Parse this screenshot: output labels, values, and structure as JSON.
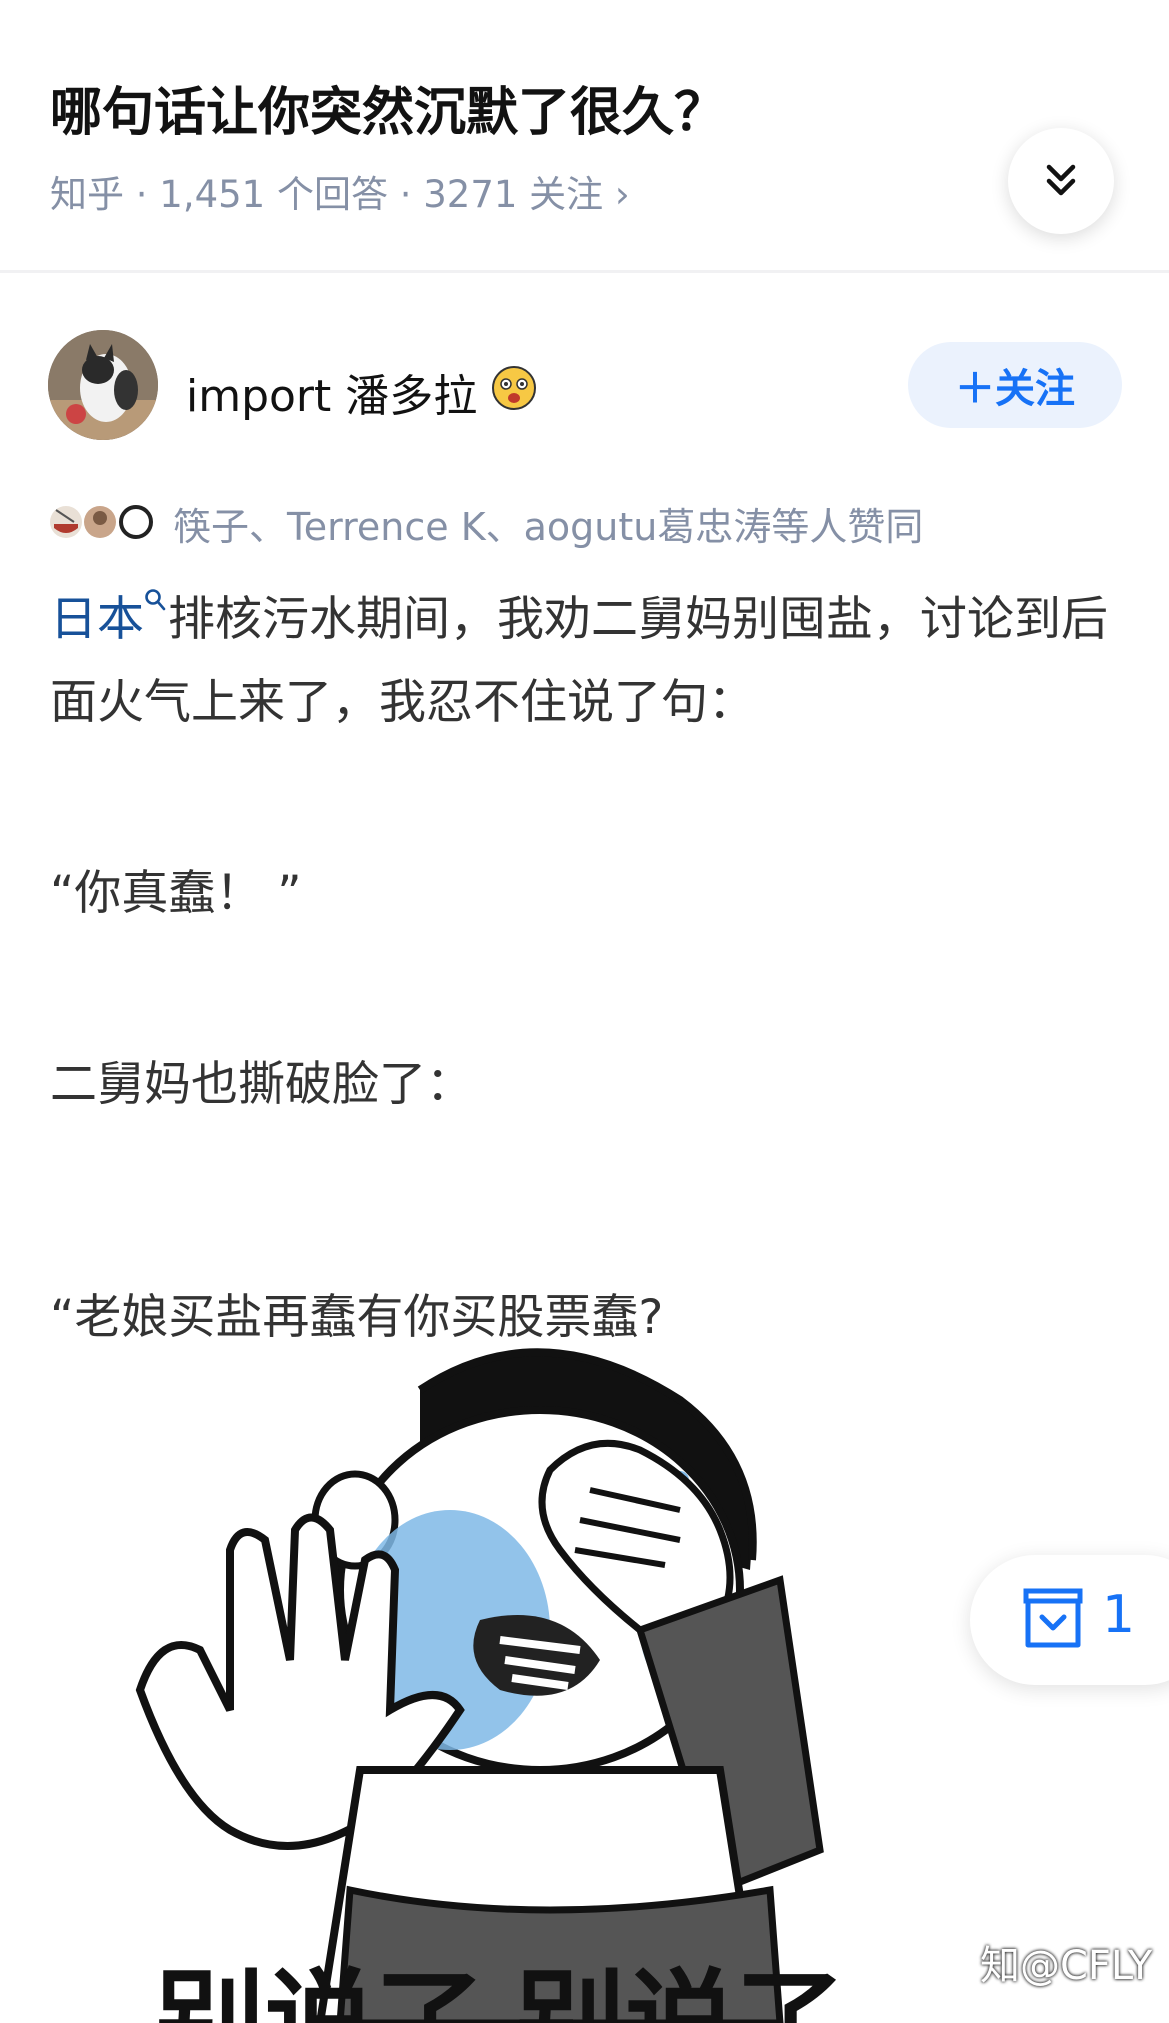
{
  "question": {
    "title": "哪句话让你突然沉默了很久？",
    "meta": "知乎 · 1,451 个回答 · 3271 关注 ›"
  },
  "author": {
    "name": "import 潘多拉",
    "follow_label": "＋关注"
  },
  "voters": {
    "text": "筷子、Terrence K、aogutu葛忠涛等人赞同"
  },
  "answer": {
    "link_term": "日本",
    "line1_rest": "排核污水期间，我劝二舅妈别囤盐，讨论到后面火气上来了，我忍不住说了句：",
    "quote1": "“你真蠢！ ”",
    "line3": "二舅妈也撕破脸了：",
    "quote2": "“老娘买盐再蠢有你买股票蠢?"
  },
  "meme": {
    "caption": "别说了 别说了"
  },
  "collect": {
    "count": "1"
  },
  "watermark": "知@CFLY",
  "icons": {
    "collapse": "double-chevron-down-icon",
    "collect": "collect-box-icon",
    "search": "search-icon"
  },
  "colors": {
    "brand_blue": "#1772f6",
    "link_blue": "#175199",
    "meta_gray": "#8590a6"
  }
}
